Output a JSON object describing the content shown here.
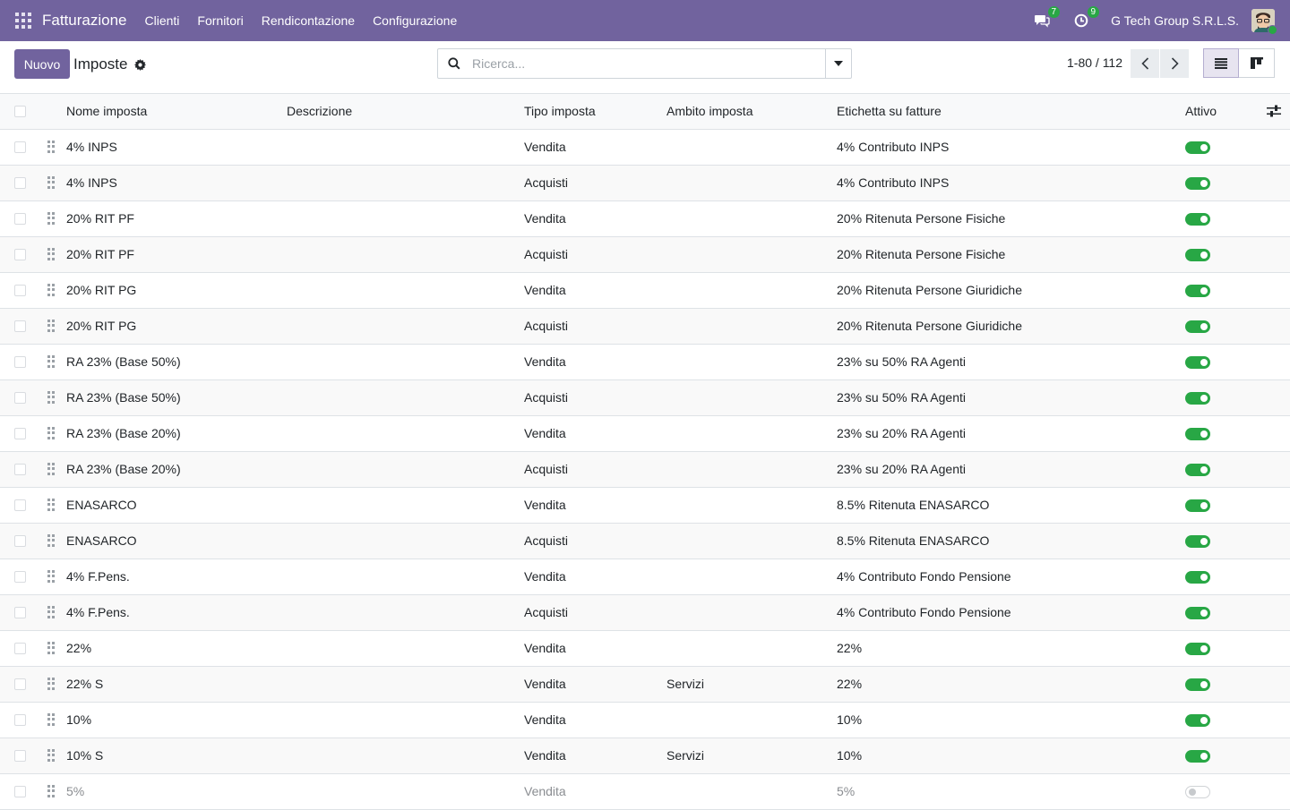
{
  "navbar": {
    "app_title": "Fatturazione",
    "menu": [
      "Clienti",
      "Fornitori",
      "Rendicontazione",
      "Configurazione"
    ],
    "messages_count": "7",
    "activities_count": "9",
    "company": "G Tech Group S.R.L.S."
  },
  "control": {
    "new_label": "Nuovo",
    "breadcrumb": "Imposte",
    "search_placeholder": "Ricerca...",
    "pager": "1-80 / 112"
  },
  "table": {
    "headers": {
      "name": "Nome imposta",
      "description": "Descrizione",
      "type": "Tipo imposta",
      "scope": "Ambito imposta",
      "label": "Etichetta su fatture",
      "active": "Attivo"
    },
    "rows": [
      {
        "name": "4% INPS",
        "description": "",
        "type": "Vendita",
        "scope": "",
        "label": "4% Contributo INPS",
        "active": true
      },
      {
        "name": "4% INPS",
        "description": "",
        "type": "Acquisti",
        "scope": "",
        "label": "4% Contributo INPS",
        "active": true
      },
      {
        "name": "20% RIT PF",
        "description": "",
        "type": "Vendita",
        "scope": "",
        "label": "20% Ritenuta Persone Fisiche",
        "active": true
      },
      {
        "name": "20% RIT PF",
        "description": "",
        "type": "Acquisti",
        "scope": "",
        "label": "20% Ritenuta Persone Fisiche",
        "active": true
      },
      {
        "name": "20% RIT PG",
        "description": "",
        "type": "Vendita",
        "scope": "",
        "label": "20% Ritenuta Persone Giuridiche",
        "active": true
      },
      {
        "name": "20% RIT PG",
        "description": "",
        "type": "Acquisti",
        "scope": "",
        "label": "20% Ritenuta Persone Giuridiche",
        "active": true
      },
      {
        "name": "RA 23% (Base 50%)",
        "description": "",
        "type": "Vendita",
        "scope": "",
        "label": "23% su 50% RA Agenti",
        "active": true
      },
      {
        "name": "RA 23% (Base 50%)",
        "description": "",
        "type": "Acquisti",
        "scope": "",
        "label": "23% su 50% RA Agenti",
        "active": true
      },
      {
        "name": "RA 23% (Base 20%)",
        "description": "",
        "type": "Vendita",
        "scope": "",
        "label": "23% su 20% RA Agenti",
        "active": true
      },
      {
        "name": "RA 23% (Base 20%)",
        "description": "",
        "type": "Acquisti",
        "scope": "",
        "label": "23% su 20% RA Agenti",
        "active": true
      },
      {
        "name": "ENASARCO",
        "description": "",
        "type": "Vendita",
        "scope": "",
        "label": "8.5% Ritenuta ENASARCO",
        "active": true
      },
      {
        "name": "ENASARCO",
        "description": "",
        "type": "Acquisti",
        "scope": "",
        "label": "8.5% Ritenuta ENASARCO",
        "active": true
      },
      {
        "name": "4% F.Pens.",
        "description": "",
        "type": "Vendita",
        "scope": "",
        "label": "4% Contributo Fondo Pensione",
        "active": true
      },
      {
        "name": "4% F.Pens.",
        "description": "",
        "type": "Acquisti",
        "scope": "",
        "label": "4% Contributo Fondo Pensione",
        "active": true
      },
      {
        "name": "22%",
        "description": "",
        "type": "Vendita",
        "scope": "",
        "label": "22%",
        "active": true
      },
      {
        "name": "22% S",
        "description": "",
        "type": "Vendita",
        "scope": "Servizi",
        "label": "22%",
        "active": true
      },
      {
        "name": "10%",
        "description": "",
        "type": "Vendita",
        "scope": "",
        "label": "10%",
        "active": true
      },
      {
        "name": "10% S",
        "description": "",
        "type": "Vendita",
        "scope": "Servizi",
        "label": "10%",
        "active": true
      },
      {
        "name": "5%",
        "description": "",
        "type": "Vendita",
        "scope": "",
        "label": "5%",
        "active": false
      }
    ]
  }
}
